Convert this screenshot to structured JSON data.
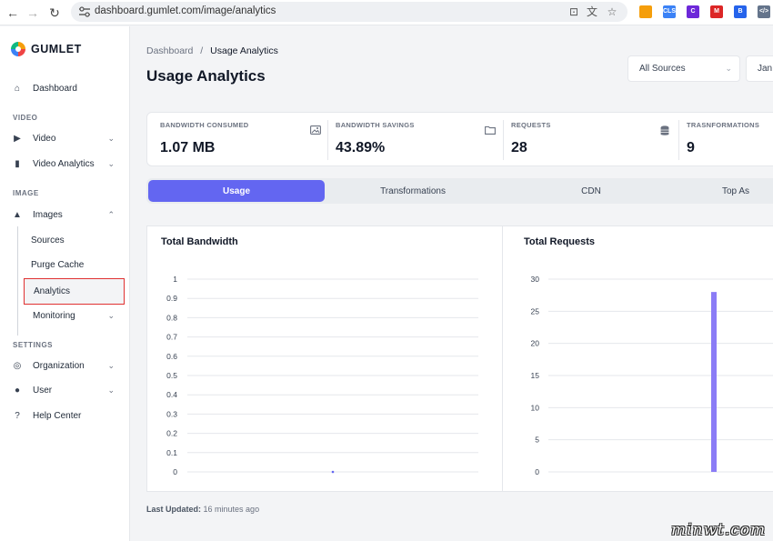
{
  "browser": {
    "url": "dashboard.gumlet.com/image/analytics",
    "extensions": [
      {
        "name": "ext-1",
        "color": "#f59e0b"
      },
      {
        "name": "cls-ext",
        "color": "#3b82f6"
      },
      {
        "name": "c-ext",
        "color": "#6d28d9"
      },
      {
        "name": "gmail-ext",
        "color": "#dc2626"
      },
      {
        "name": "b-ext",
        "color": "#2563eb"
      },
      {
        "name": "code-ext",
        "color": "#64748b"
      }
    ]
  },
  "sidebar": {
    "brand": "GUMLET",
    "dashboard": "Dashboard",
    "section_video": "VIDEO",
    "video": "Video",
    "video_analytics": "Video Analytics",
    "section_image": "IMAGE",
    "images": "Images",
    "sources": "Sources",
    "purge_cache": "Purge Cache",
    "analytics": "Analytics",
    "monitoring": "Monitoring",
    "section_settings": "SETTINGS",
    "organization": "Organization",
    "user": "User",
    "help_center": "Help Center"
  },
  "header": {
    "breadcrumb_root": "Dashboard",
    "breadcrumb_sep": "/",
    "breadcrumb_current": "Usage Analytics",
    "title": "Usage Analytics",
    "source_filter": "All Sources",
    "date_filter": "Jan"
  },
  "stats": [
    {
      "label": "BANDWIDTH CONSUMED",
      "value": "1.07 MB",
      "icon": "image-icon"
    },
    {
      "label": "BANDWIDTH SAVINGS",
      "value": "43.89%",
      "icon": "folder-icon"
    },
    {
      "label": "REQUESTS",
      "value": "28",
      "icon": "database-icon"
    },
    {
      "label": "TRASNFORMATIONS",
      "value": "9",
      "icon": ""
    }
  ],
  "tabs": [
    "Usage",
    "Transformations",
    "CDN",
    "Top As"
  ],
  "active_tab": "Usage",
  "chart_data": [
    {
      "type": "line",
      "title": "Total Bandwidth",
      "yticks": [
        "1",
        "0.9",
        "0.8",
        "0.7",
        "0.6",
        "0.5",
        "0.4",
        "0.3",
        "0.2",
        "0.1",
        "0"
      ],
      "ylim": [
        0,
        1
      ],
      "points": [
        {
          "x": 0.5,
          "y": 0
        }
      ],
      "color": "#6366f1"
    },
    {
      "type": "bar",
      "title": "Total Requests",
      "yticks": [
        "30",
        "25",
        "20",
        "15",
        "10",
        "5",
        "0"
      ],
      "ylim": [
        0,
        30
      ],
      "bars": [
        {
          "x": 0.7,
          "value": 28
        }
      ],
      "color": "#8b7cf6"
    }
  ],
  "footer": {
    "updated_label": "Last Updated:",
    "updated_value": "16 minutes ago"
  },
  "watermark": "minwt.com"
}
